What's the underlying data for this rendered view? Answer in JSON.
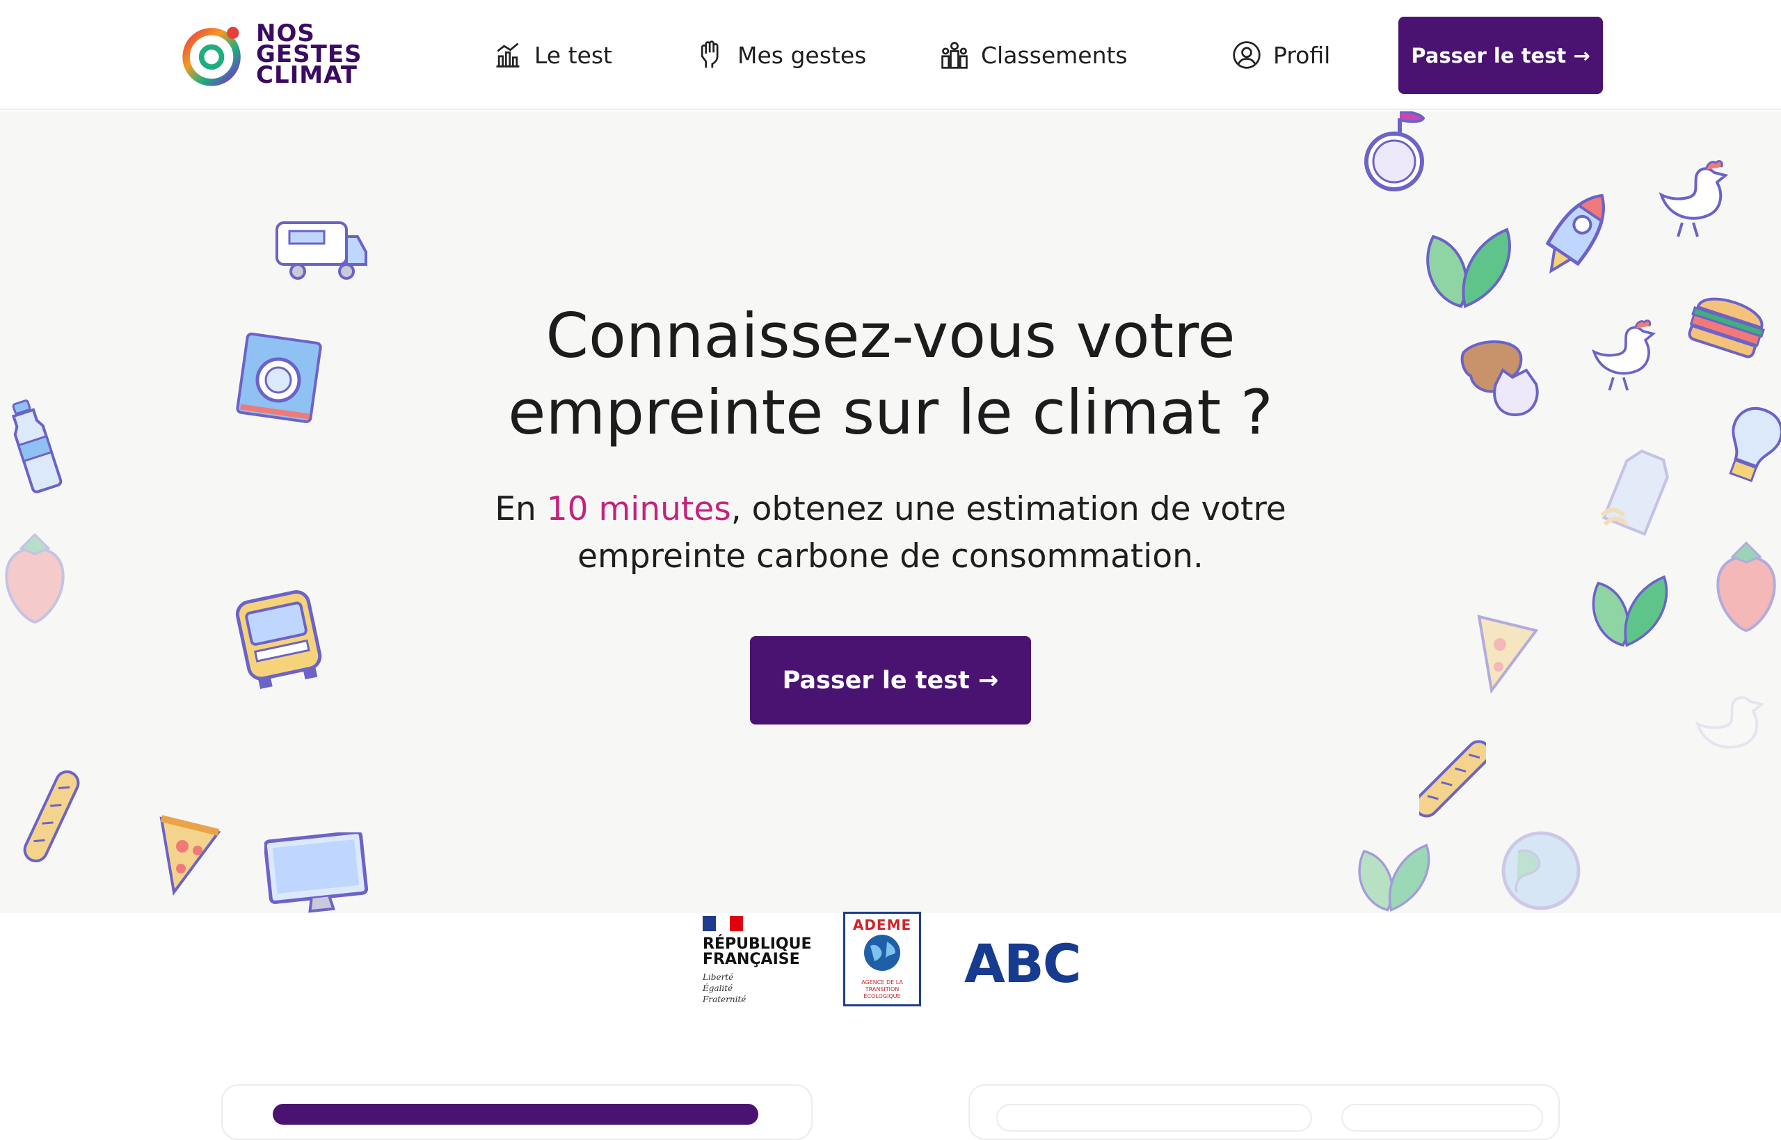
{
  "header": {
    "logo_lines": [
      "NOS",
      "GESTES",
      "CLIMAT"
    ],
    "nav": [
      {
        "label": "Le test",
        "icon": "chart-icon"
      },
      {
        "label": "Mes gestes",
        "icon": "hand-icon"
      },
      {
        "label": "Classements",
        "icon": "group-icon"
      },
      {
        "label": "Profil",
        "icon": "user-circle-icon"
      }
    ],
    "cta_label": "Passer le test →"
  },
  "hero": {
    "title_line1": "Connaissez-vous votre",
    "title_line2": "empreinte sur le climat ?",
    "subtitle_prefix": "En ",
    "subtitle_highlight": "10 minutes",
    "subtitle_rest": ", obtenez une estimation de votre",
    "subtitle_line2": "empreinte carbone de consommation.",
    "cta_label": "Passer le test →"
  },
  "partners": {
    "rf_line1": "RÉPUBLIQUE",
    "rf_line2": "FRANÇAISE",
    "rf_motto": [
      "Liberté",
      "Égalité",
      "Fraternité"
    ],
    "ademe_title": "ADEME",
    "ademe_sub": [
      "AGENCE DE LA",
      "TRANSITION",
      "ÉCOLOGIQUE"
    ],
    "abc_logo": "ABC"
  },
  "colors": {
    "brand_purple": "#4a1372",
    "highlight_pink": "#c4227d",
    "hero_bg": "#f7f7f6"
  }
}
